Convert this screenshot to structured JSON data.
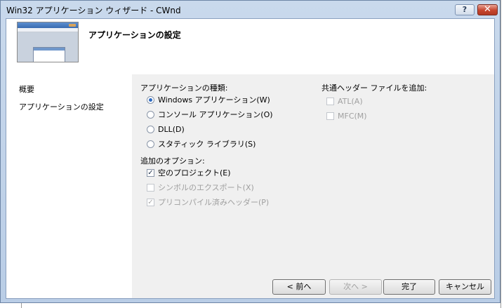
{
  "window": {
    "title": "Win32 アプリケーション ウィザード - CWnd",
    "help_label": "?",
    "close_label": "✕"
  },
  "header": {
    "title": "アプリケーションの設定"
  },
  "sidebar": {
    "items": [
      {
        "label": "概要"
      },
      {
        "label": "アプリケーションの設定"
      }
    ]
  },
  "app_type": {
    "heading": "アプリケーションの種類:",
    "options": [
      {
        "label": "Windows アプリケーション(W)",
        "selected": true
      },
      {
        "label": "コンソール アプリケーション(O)",
        "selected": false
      },
      {
        "label": "DLL(D)",
        "selected": false
      },
      {
        "label": "スタティック ライブラリ(S)",
        "selected": false
      }
    ]
  },
  "additional": {
    "heading": "追加のオプション:",
    "options": [
      {
        "label": "空のプロジェクト(E)",
        "checked": true,
        "enabled": true
      },
      {
        "label": "シンボルのエクスポート(X)",
        "checked": false,
        "enabled": false
      },
      {
        "label": "プリコンパイル済みヘッダー(P)",
        "checked": true,
        "enabled": false
      }
    ]
  },
  "common_headers": {
    "heading": "共通ヘッダー ファイルを追加:",
    "options": [
      {
        "label": "ATL(A)",
        "checked": false,
        "enabled": false
      },
      {
        "label": "MFC(M)",
        "checked": false,
        "enabled": false
      }
    ]
  },
  "footer": {
    "back_label": "< 前へ",
    "next_label": "次へ >",
    "finish_label": "完了",
    "cancel_label": "キャンセル"
  },
  "check_glyph": "✓"
}
